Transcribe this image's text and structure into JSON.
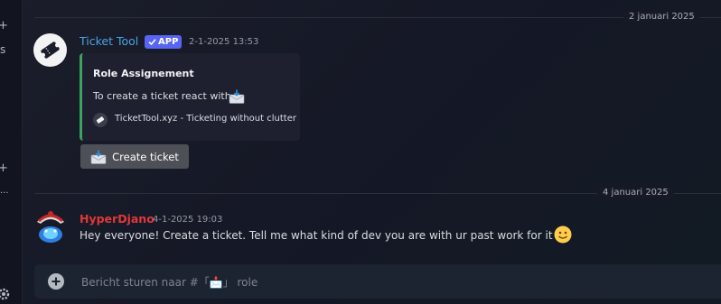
{
  "left_rail": {
    "glyphs": [
      "+",
      "s",
      "+",
      "..."
    ]
  },
  "dividers": [
    {
      "date": "2 januari 2025"
    },
    {
      "date": "4 januari 2025"
    }
  ],
  "messages": [
    {
      "author": "Ticket Tool",
      "badge": "APP",
      "timestamp": "2-1-2025 13:53",
      "embed": {
        "title": "Role Assignement",
        "description": "To create a ticket react with",
        "description_icon": "envelope-incoming-icon",
        "footer_text": "TicketTool.xyz - Ticketing without clutter",
        "accent_color": "#3ba55c"
      },
      "button": {
        "label": "Create ticket",
        "icon": "envelope-incoming-icon"
      }
    },
    {
      "author": "HyperDjano",
      "author_color": "#e13838",
      "timestamp": "4-1-2025 19:03",
      "text": "Hey everyone! Create a ticket. Tell me what kind of dev you are with ur past work for it",
      "emoji": "slightly-smiling-face-icon"
    }
  ],
  "composer": {
    "placeholder": "Bericht sturen naar #「📩」 role"
  },
  "colors": {
    "brand": "#5865f2",
    "link": "#4aa3e8"
  }
}
